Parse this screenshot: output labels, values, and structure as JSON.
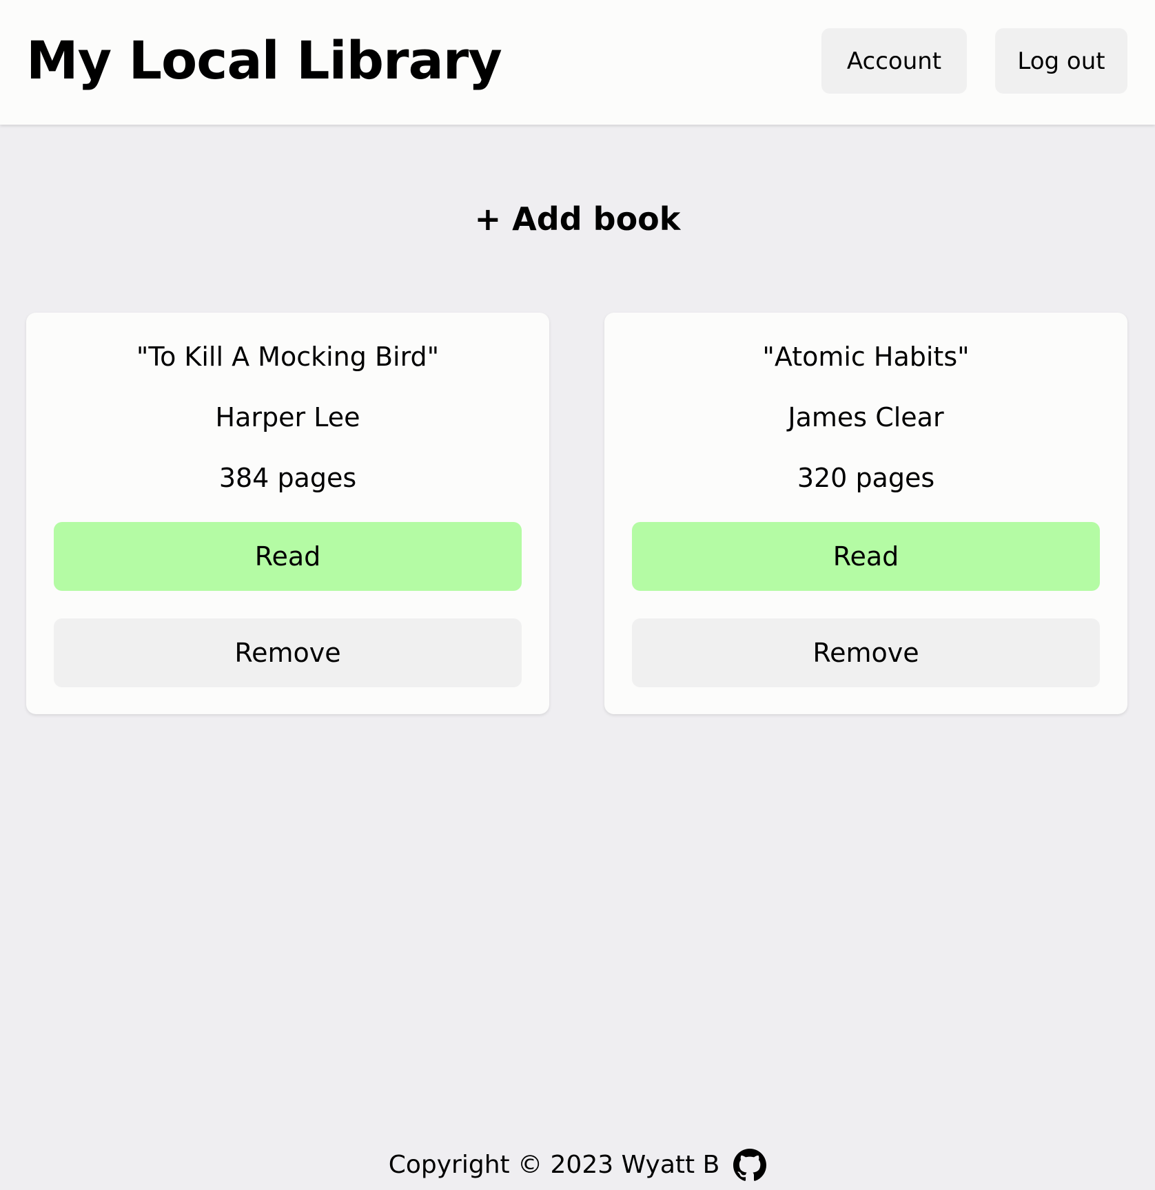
{
  "header": {
    "title": "My Local Library",
    "account_label": "Account",
    "logout_label": "Log out"
  },
  "main": {
    "add_book_label": "+ Add book",
    "books": [
      {
        "title": "\"To Kill A Mocking Bird\"",
        "author": "Harper Lee",
        "pages": "384 pages",
        "read_label": "Read",
        "remove_label": "Remove"
      },
      {
        "title": "\"Atomic Habits\"",
        "author": "James Clear",
        "pages": "320 pages",
        "read_label": "Read",
        "remove_label": "Remove"
      }
    ]
  },
  "footer": {
    "copyright": "Copyright © 2023 Wyatt B",
    "icon": "github-icon"
  },
  "colors": {
    "background": "#efeef1",
    "surface": "#fcfcfb",
    "read_button": "#b4fba4",
    "neutral_button": "#f0f0f0"
  }
}
